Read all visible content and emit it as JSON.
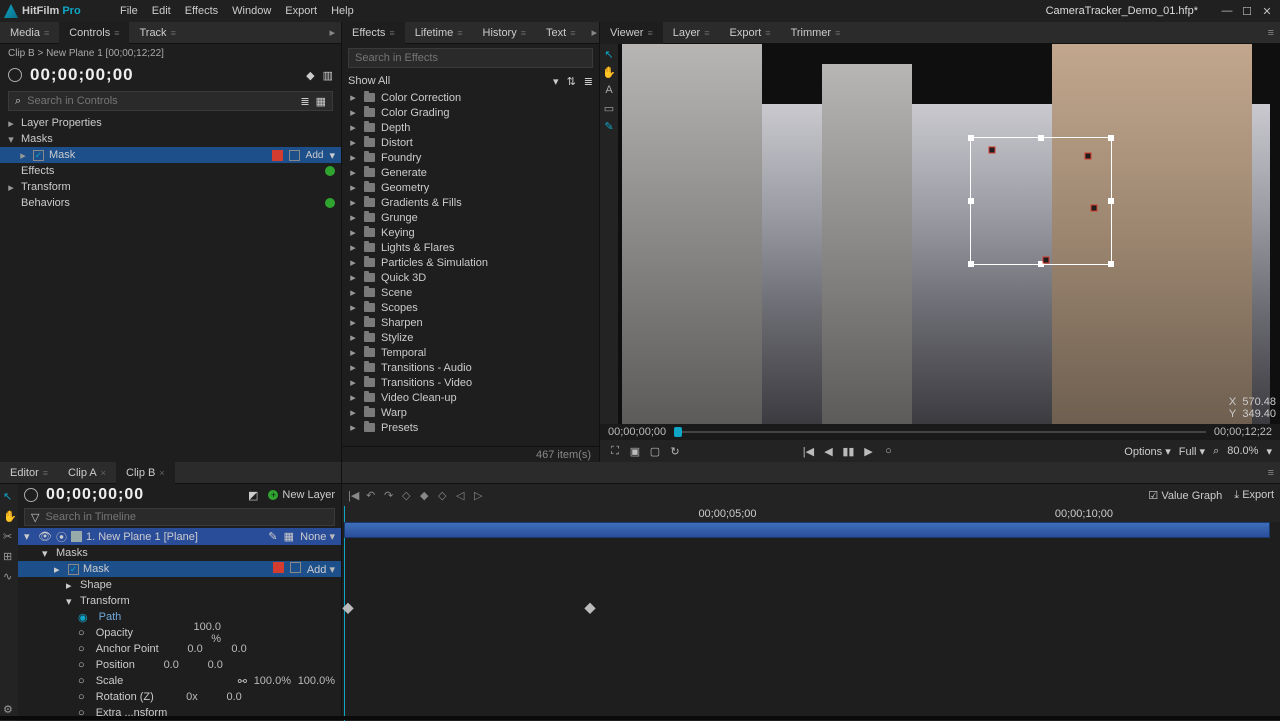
{
  "app": {
    "name": "HitFilm",
    "suffix": "Pro",
    "document": "CameraTracker_Demo_01.hfp*"
  },
  "menus": [
    "File",
    "Edit",
    "Effects",
    "Window",
    "Export",
    "Help"
  ],
  "left_tabs": [
    "Media",
    "Controls",
    "Track"
  ],
  "left_tabs_active": 1,
  "mid_tabs": [
    "Effects",
    "Lifetime",
    "History",
    "Text"
  ],
  "mid_tabs_active": 0,
  "right_tabs": [
    "Viewer",
    "Layer",
    "Export",
    "Trimmer"
  ],
  "right_tabs_active": 0,
  "controls": {
    "breadcrumb": "Clip B > New Plane 1 [00;00;12;22]",
    "timecode": "00;00;00;00",
    "search_placeholder": "Search in Controls",
    "tree": {
      "layer_properties": "Layer Properties",
      "masks": "Masks",
      "mask": "Mask",
      "mask_mode": "Add",
      "effects": "Effects",
      "transform": "Transform",
      "behaviors": "Behaviors"
    }
  },
  "effects": {
    "search_placeholder": "Search in Effects",
    "filter": "Show All",
    "categories": [
      "Color Correction",
      "Color Grading",
      "Depth",
      "Distort",
      "Foundry",
      "Generate",
      "Geometry",
      "Gradients & Fills",
      "Grunge",
      "Keying",
      "Lights & Flares",
      "Particles & Simulation",
      "Quick 3D",
      "Scene",
      "Scopes",
      "Sharpen",
      "Stylize",
      "Temporal",
      "Transitions - Audio",
      "Transitions - Video",
      "Video Clean-up",
      "Warp",
      "Presets"
    ],
    "count": "467 item(s)"
  },
  "viewer": {
    "scrub_in": "00;00;00;00",
    "scrub_out": "00;00;12;22",
    "options": "Options",
    "quality": "Full",
    "zoom": "80.0%",
    "overlay_x_label": "X",
    "overlay_x": "570.48",
    "overlay_y_label": "Y",
    "overlay_y": "349.40"
  },
  "editor_tabs": [
    "Editor",
    "Clip A",
    "Clip B"
  ],
  "editor_tabs_active": 2,
  "timeline": {
    "timecode": "00;00;00;00",
    "new_layer": "New Layer",
    "search_placeholder": "Search in Timeline",
    "value_graph": "Value Graph",
    "export": "Export",
    "ruler": [
      "00;00;05;00",
      "00;00;10;00"
    ],
    "layer": {
      "name": "1. New Plane 1 [Plane]",
      "blend": "None",
      "masks": "Masks",
      "mask": "Mask",
      "mask_mode": "Add",
      "shape": "Shape",
      "transform": "Transform",
      "props": [
        {
          "name": "Path",
          "v1": "",
          "v2": ""
        },
        {
          "name": "Opacity",
          "v1": "",
          "v2": "100.0 %"
        },
        {
          "name": "Anchor Point",
          "v1": "0.0",
          "v2": "0.0"
        },
        {
          "name": "Position",
          "v1": "0.0",
          "v2": "0.0"
        },
        {
          "name": "Scale",
          "v1": "100.0%",
          "v2": "100.0%"
        },
        {
          "name": "Rotation (Z)",
          "v1": "0x",
          "v2": "0.0"
        },
        {
          "name": "Extra ...nsform",
          "v1": "",
          "v2": ""
        }
      ]
    }
  },
  "colors": {
    "accent": "#0ea5c6",
    "selection": "#1d4f8b",
    "mask": "#d43c2f",
    "add_green": "#2fa52f"
  }
}
